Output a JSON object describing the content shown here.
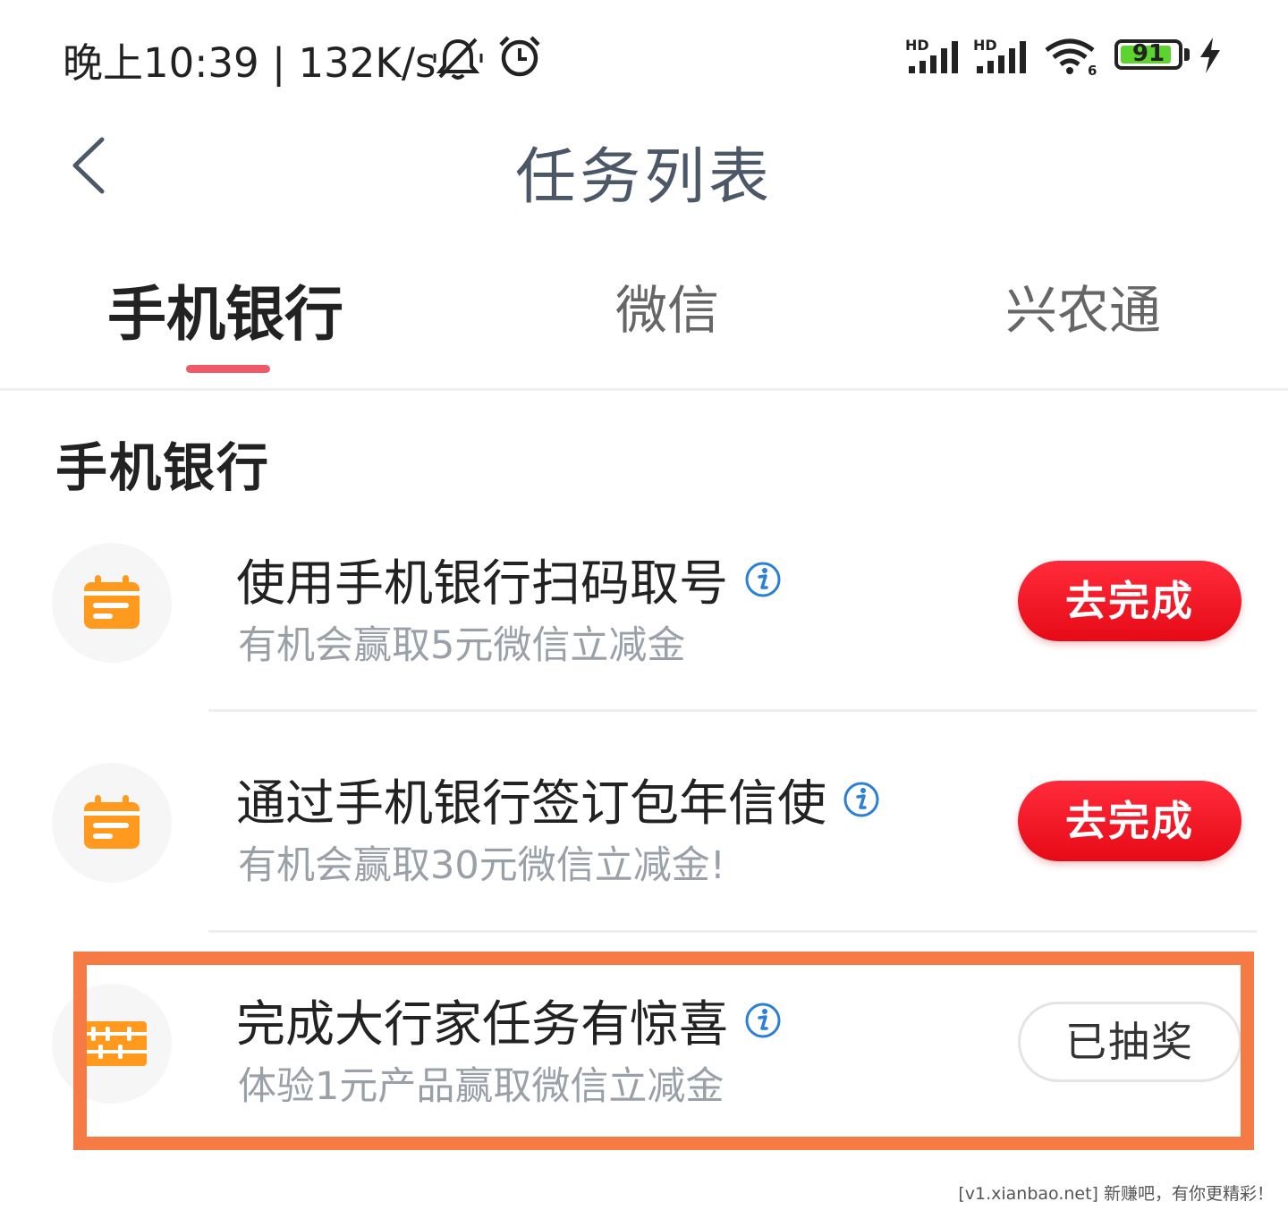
{
  "status_bar": {
    "time_speed": "晚上10:39 | 132K/s",
    "battery_level": "91",
    "battery_fraction": 0.91,
    "icons": [
      "mute-icon",
      "alarm-icon",
      "hd-signal-icon",
      "hd-signal-icon",
      "wifi-icon",
      "battery-icon",
      "charging-icon"
    ]
  },
  "header": {
    "title": "任务列表",
    "back_icon": "chevron-left-icon"
  },
  "tabs": [
    {
      "label": "手机银行",
      "active": true
    },
    {
      "label": "微信",
      "active": false
    },
    {
      "label": "兴农通",
      "active": false
    }
  ],
  "section": {
    "title": "手机银行"
  },
  "tasks": [
    {
      "title": "使用手机银行扫码取号",
      "subtitle": "有机会赢取5元微信立减金",
      "button": "去完成",
      "icon": "calendar-icon"
    },
    {
      "title": "通过手机银行签订包年信使",
      "subtitle": "有机会赢取30元微信立减金!",
      "button": "去完成",
      "icon": "calendar-icon"
    },
    {
      "title": "完成大行家任务有惊喜",
      "subtitle": "体验1元产品赢取微信立减金",
      "button": "已抽奖",
      "icon": "abacus-icon"
    }
  ],
  "colors": {
    "accent_red": "#e60a16",
    "tab_indicator": "#ef5a69",
    "icon_orange": "#ff9a1f",
    "highlight_orange": "#f57a44"
  },
  "watermark": "[v1.xianbao.net] 新赚吧，有你更精彩！"
}
